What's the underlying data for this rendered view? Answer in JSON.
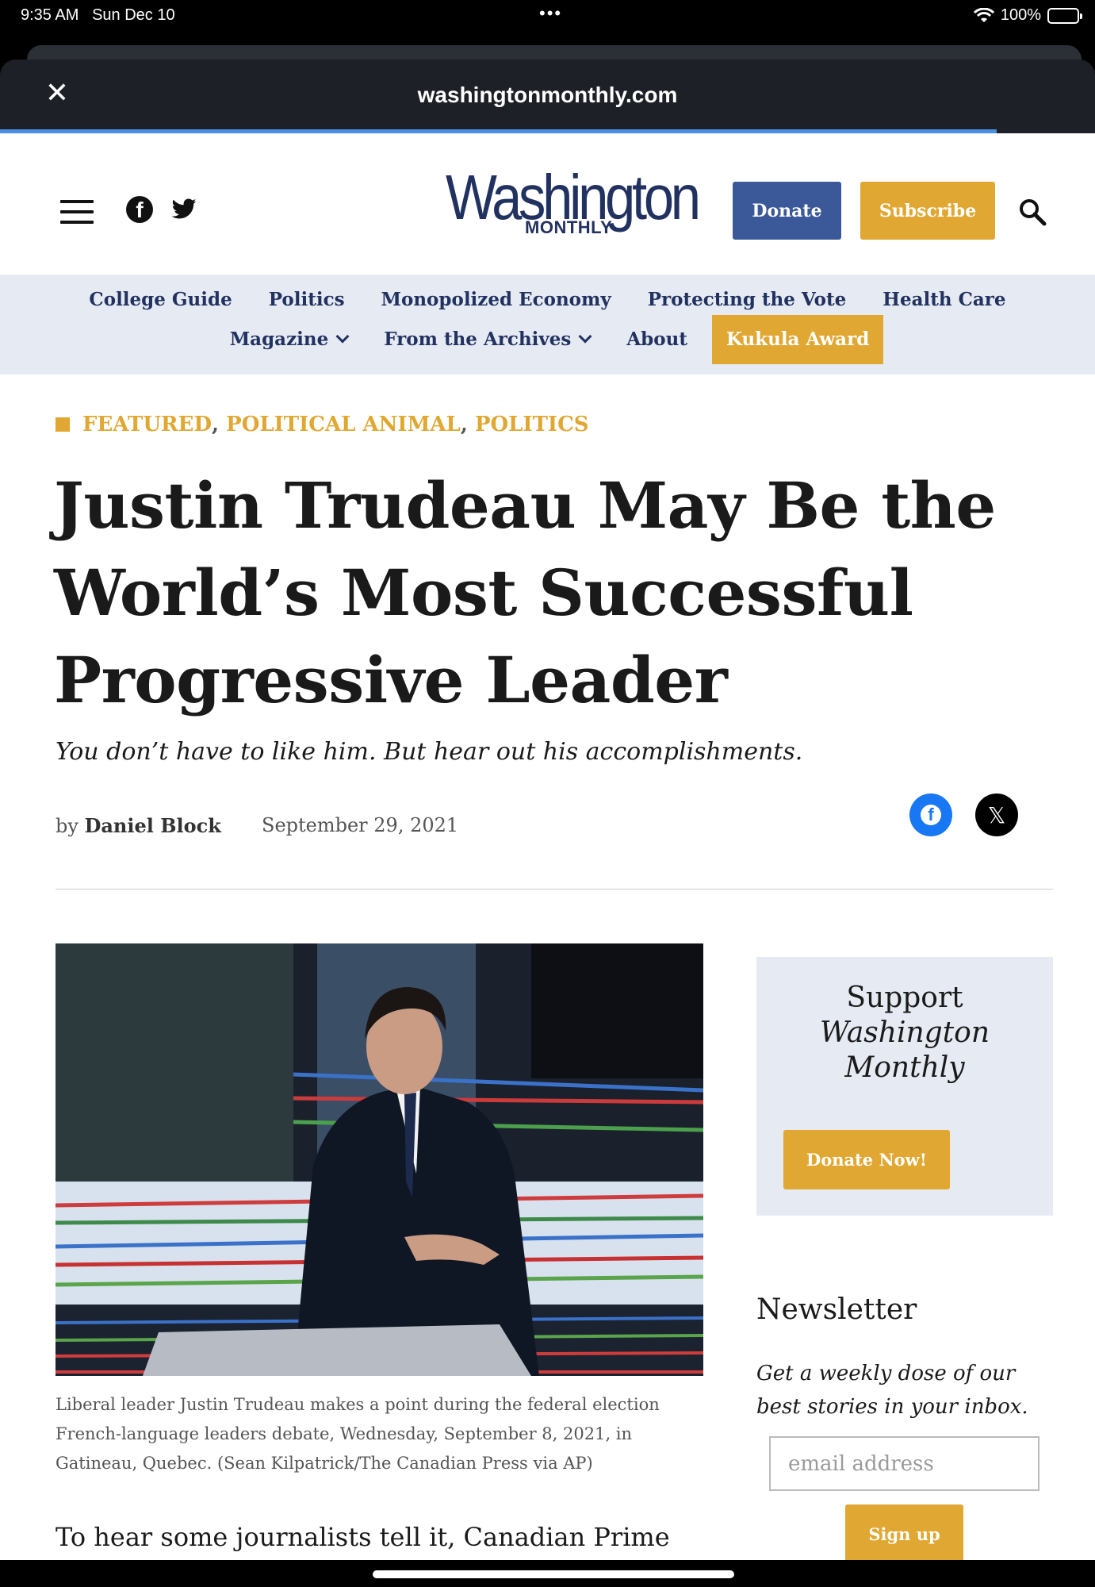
{
  "status_bar": {
    "time": "9:35 AM",
    "date": "Sun Dec 10",
    "battery": "100%"
  },
  "browser": {
    "url": "washingtonmonthly.com",
    "close_icon": "close-icon",
    "load_progress": 0.91
  },
  "header": {
    "logo_main": "Washington",
    "logo_sub": "MONTHLY",
    "donate_label": "Donate",
    "subscribe_label": "Subscribe",
    "icons": [
      "menu-icon",
      "facebook-icon",
      "twitter-icon",
      "search-icon"
    ]
  },
  "nav": {
    "row1": [
      {
        "label": "College Guide"
      },
      {
        "label": "Politics"
      },
      {
        "label": "Monopolized Economy"
      },
      {
        "label": "Protecting the Vote"
      },
      {
        "label": "Health Care"
      }
    ],
    "row2": [
      {
        "label": "Magazine"
      },
      {
        "label": "From the Archives"
      },
      {
        "label": "About"
      },
      {
        "label": "Kukula Award"
      }
    ]
  },
  "article": {
    "categories": [
      "FEATURED",
      "POLITICAL ANIMAL",
      "POLITICS"
    ],
    "headline": "Justin Trudeau May Be the World’s Most Successful Progressive Leader",
    "dek": "You don’t have to like him. But hear out his accomplishments.",
    "by": "by",
    "author": "Daniel Block",
    "date": "September 29, 2021",
    "caption": "Liberal leader Justin Trudeau makes a point during the federal election French-language leaders debate, Wednesday, September 8, 2021, in Gatineau, Quebec. (Sean Kilpatrick/The Canadian Press via AP)",
    "body_start": "To hear some journalists tell it, Canadian Prime"
  },
  "sidebar": {
    "support_line1": "Support",
    "support_line2": "Washington",
    "support_line3": "Monthly",
    "donate_now_label": "Donate Now!",
    "newsletter_title": "Newsletter",
    "newsletter_desc": "Get a weekly dose of our best stories in your inbox.",
    "email_placeholder": "email address",
    "signup_label": "Sign up"
  },
  "colors": {
    "navy": "#223260",
    "gold": "#e0a732",
    "nav_bg": "#e6eaf3",
    "donate_blue": "#3b5998"
  }
}
